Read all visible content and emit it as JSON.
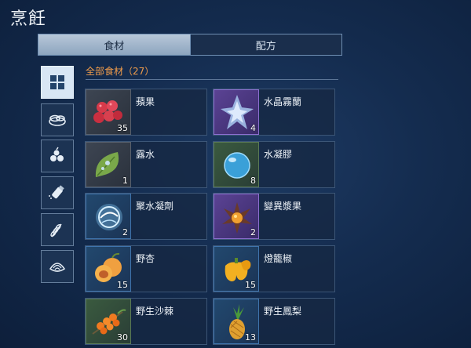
{
  "title": "烹飪",
  "tabs": [
    {
      "label": "食材",
      "active": true
    },
    {
      "label": "配方",
      "active": false
    }
  ],
  "categories": [
    {
      "icon": "grid-icon",
      "active": true
    },
    {
      "icon": "plates-icon",
      "active": false
    },
    {
      "icon": "fruit-icon",
      "active": false
    },
    {
      "icon": "salt-shaker-icon",
      "active": false
    },
    {
      "icon": "wheat-icon",
      "active": false
    },
    {
      "icon": "shell-icon",
      "active": false
    }
  ],
  "section_label": "全部食材（27）",
  "items": [
    {
      "name": "蘋果",
      "qty": "35",
      "icon": "berries-icon",
      "rarity": "gray"
    },
    {
      "name": "水晶霧蘭",
      "qty": "4",
      "icon": "crystal-orchid-icon",
      "rarity": "purple"
    },
    {
      "name": "露水",
      "qty": "1",
      "icon": "leaf-dew-icon",
      "rarity": "gray"
    },
    {
      "name": "水凝膠",
      "qty": "8",
      "icon": "water-gel-icon",
      "rarity": "green"
    },
    {
      "name": "聚水凝劑",
      "qty": "2",
      "icon": "water-orb-icon",
      "rarity": "blue"
    },
    {
      "name": "變異漿果",
      "qty": "2",
      "icon": "mutant-berry-icon",
      "rarity": "purple"
    },
    {
      "name": "野杏",
      "qty": "15",
      "icon": "apricot-icon",
      "rarity": "blue"
    },
    {
      "name": "燈籠椒",
      "qty": "15",
      "icon": "bell-pepper-icon",
      "rarity": "blue"
    },
    {
      "name": "野生沙棘",
      "qty": "30",
      "icon": "sea-buckthorn-icon",
      "rarity": "green"
    },
    {
      "name": "野生鳳梨",
      "qty": "13",
      "icon": "pineapple-icon",
      "rarity": "blue"
    }
  ],
  "colors": {
    "accent_orange": "#f29d4b",
    "tab_active": "#a9bcd1",
    "background": "#142c4f"
  }
}
